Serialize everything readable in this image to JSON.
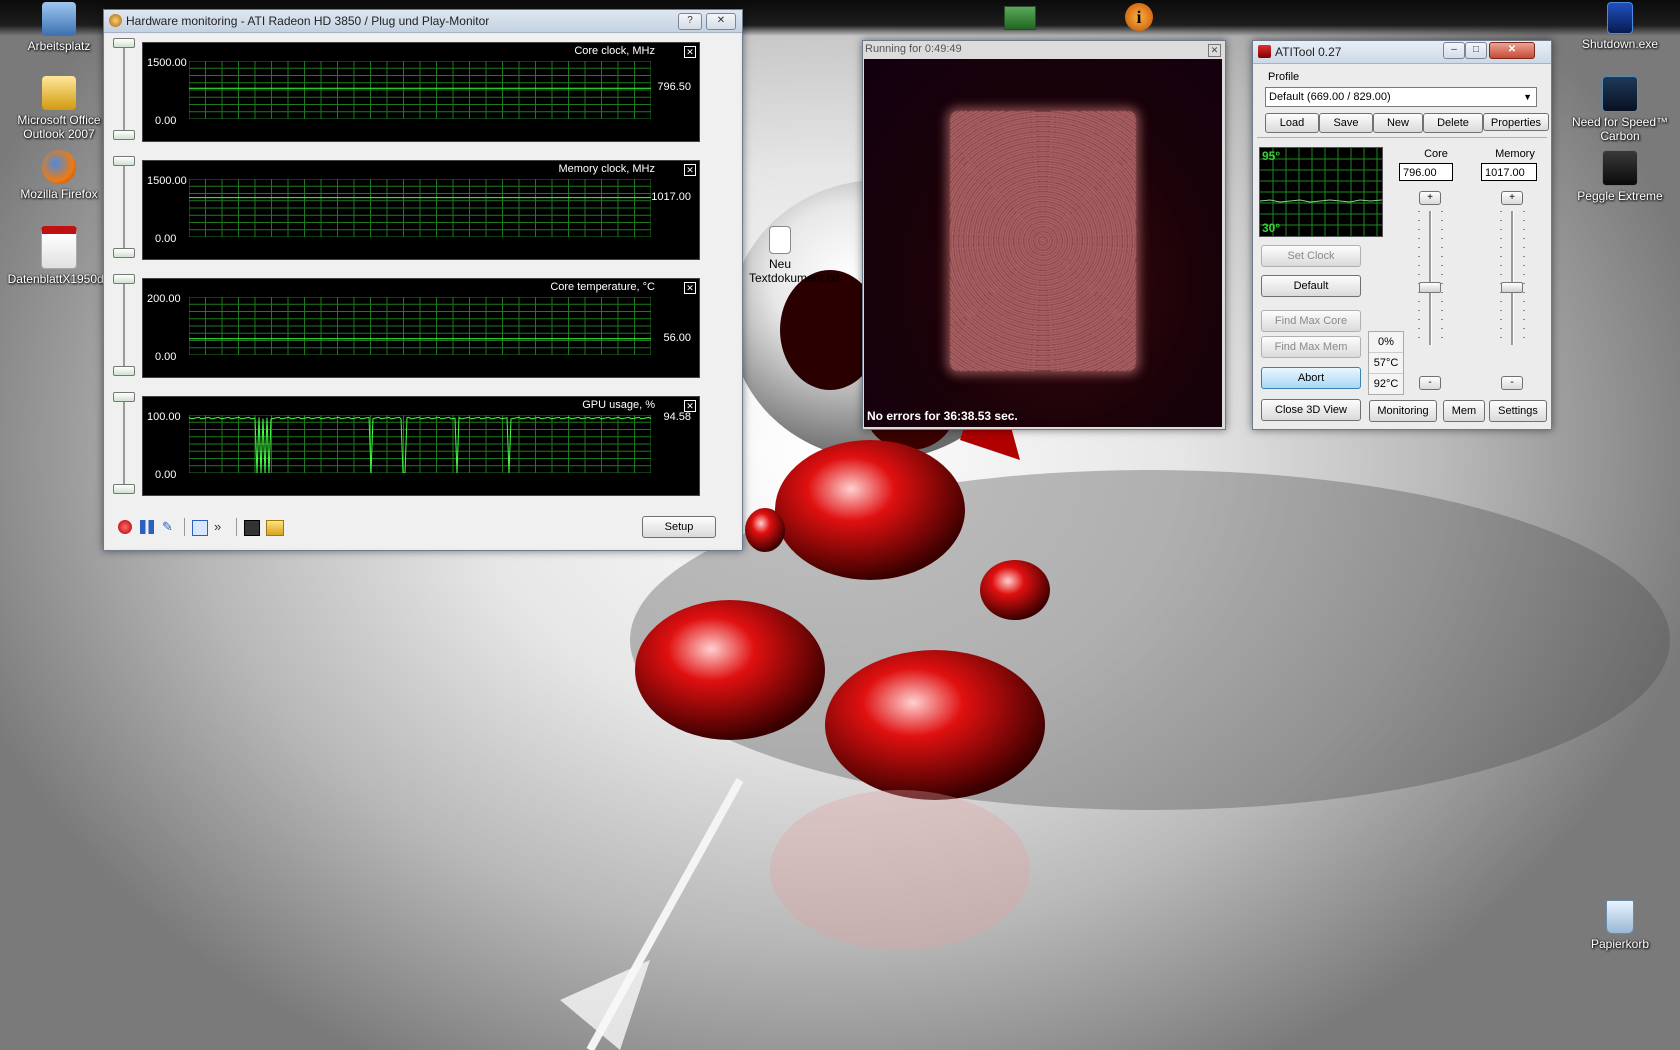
{
  "desktop": {
    "icons_left": [
      {
        "label": "Arbeitsplatz",
        "icon": "computer-icon"
      },
      {
        "label": "Microsoft Office Outlook 2007",
        "icon": "outlook-icon"
      },
      {
        "label": "Mozilla Firefox",
        "icon": "firefox-icon"
      },
      {
        "label": "DatenblattX1950de",
        "icon": "pdf-icon"
      }
    ],
    "icons_right": [
      {
        "label": "Shutdown.exe",
        "icon": "shutdown-icon"
      },
      {
        "label": "Need for Speed™ Carbon",
        "icon": "nfs-icon"
      },
      {
        "label": "Peggle Extreme",
        "icon": "steam-icon"
      },
      {
        "label": "Papierkorb",
        "icon": "recycle-bin-icon"
      }
    ],
    "icon_middle": {
      "label": "Neu Textdokument.txt",
      "icon": "text-file-icon"
    }
  },
  "hw_monitor": {
    "title": "Hardware monitoring - ATI Radeon HD 3850 / Plug und Play-Monitor",
    "help_label": "?",
    "close_label": "✕",
    "panels": [
      {
        "title": "Core clock, MHz",
        "ymax": "1500.00",
        "ymin": "0.00",
        "current": "796.50",
        "level": 0.531
      },
      {
        "title": "Memory clock, MHz",
        "ymax": "1500.00",
        "ymin": "0.00",
        "current": "1017.00",
        "level": 0.678
      },
      {
        "title": "Core temperature, °C",
        "ymax": "200.00",
        "ymin": "0.00",
        "current": "56.00",
        "level": 0.28
      },
      {
        "title": "GPU usage, %",
        "ymax": "100.00",
        "ymin": "0.00",
        "current": "94.58",
        "level": 0.9458
      }
    ],
    "setup_label": "Setup",
    "toolbar_icons": [
      "record-icon",
      "pause-icon",
      "highlight-icon",
      "windows-icon",
      "expand-icon",
      "save-icon",
      "open-folder-icon"
    ]
  },
  "view3d": {
    "title": "Running for 0:49:49",
    "status": "No errors for 36:38.53 sec."
  },
  "atitool": {
    "title": "ATITool 0.27",
    "profile_label": "Profile",
    "profile_value": "Default (669.00 / 829.00)",
    "buttons": {
      "load": "Load",
      "save": "Save",
      "new": "New",
      "delete": "Delete",
      "properties": "Properties"
    },
    "temp_graph": {
      "top": "95°",
      "bottom": "30°"
    },
    "core_label": "Core",
    "memory_label": "Memory",
    "core_value": "796.00",
    "memory_value": "1017.00",
    "plus": "+",
    "minus": "-",
    "set_clock": "Set Clock",
    "default": "Default",
    "find_max_core": "Find Max Core",
    "find_max_mem": "Find Max Mem",
    "abort": "Abort",
    "close_3d": "Close 3D View",
    "monitoring": "Monitoring",
    "mem": "Mem",
    "settings": "Settings",
    "readouts": [
      "0%",
      "57°C",
      "92°C"
    ]
  }
}
